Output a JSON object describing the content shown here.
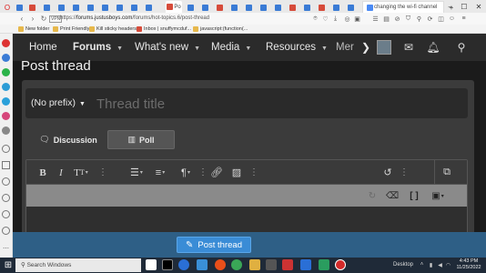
{
  "browser": {
    "active_tab_label": "Po",
    "other_tab_label": "N",
    "search_tab_label": "changing the wi-fi channel",
    "window_controls": [
      "–",
      "☐",
      "✕"
    ],
    "url_prefix": "https://",
    "url_host": "forums.justusboys.com",
    "url_path": "/forums/hot-topics.6/post-thread",
    "vpn_badge": "VPN",
    "bookmarks": [
      "New folder",
      "Print Friendly",
      "Kill sticky headers",
      "Inbox | snuffymcduf...",
      "javascript:(function(..."
    ]
  },
  "nav": {
    "items": [
      {
        "label": "Home",
        "has_caret": false
      },
      {
        "label": "Forums",
        "has_caret": true
      },
      {
        "label": "What's new",
        "has_caret": true
      },
      {
        "label": "Media",
        "has_caret": true
      },
      {
        "label": "Resources",
        "has_caret": true
      },
      {
        "label": "Mer",
        "has_caret": false
      }
    ],
    "more_arrow": "❯",
    "caret": "▼"
  },
  "page": {
    "title": "Post thread",
    "prefix_label": "(No prefix)",
    "title_placeholder": "Thread title",
    "tabs": {
      "discussion": "Discussion",
      "poll": "Poll"
    },
    "submit_label": "Post thread"
  },
  "editor": {
    "bold": "B",
    "italic": "I",
    "textsize": "T",
    "caret": "▾"
  },
  "taskbar": {
    "search_placeholder": "Search Windows",
    "desktop_label": "Desktop",
    "time": "4:43 PM",
    "date": "11/25/2022"
  },
  "colors": {
    "accent": "#3a8cd6",
    "submit_bar": "#2e5f86",
    "nav_bg": "#2b2b2b",
    "panel_bg": "#3b3b3b"
  }
}
